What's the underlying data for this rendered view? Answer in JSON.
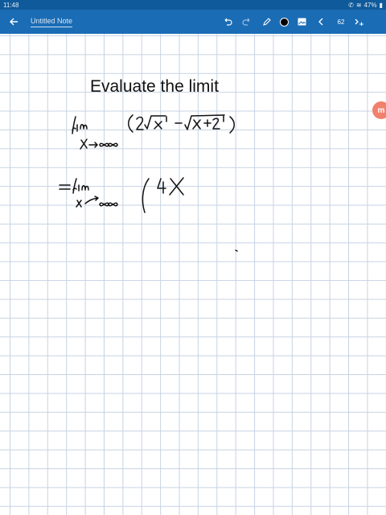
{
  "status_bar": {
    "time": "11:48",
    "battery": "47%"
  },
  "toolbar": {
    "note_title": "Untitled Note",
    "page_number": "62",
    "icons": {
      "back": "arrow-left-icon",
      "undo": "undo-icon",
      "redo": "redo-icon",
      "pen": "pen-icon",
      "color": "color-dot-icon",
      "image": "image-icon",
      "prev": "chevron-left-icon",
      "next": "add-page-icon"
    },
    "pen_color": "#000000",
    "bar_color": "#1a6cb5"
  },
  "page": {
    "heading": "Evaluate the limit",
    "grid_color": "#c7d3e3",
    "ink_color": "#111111"
  },
  "floating_button": {
    "icon": "app-logo-icon",
    "color": "#f1816c"
  }
}
